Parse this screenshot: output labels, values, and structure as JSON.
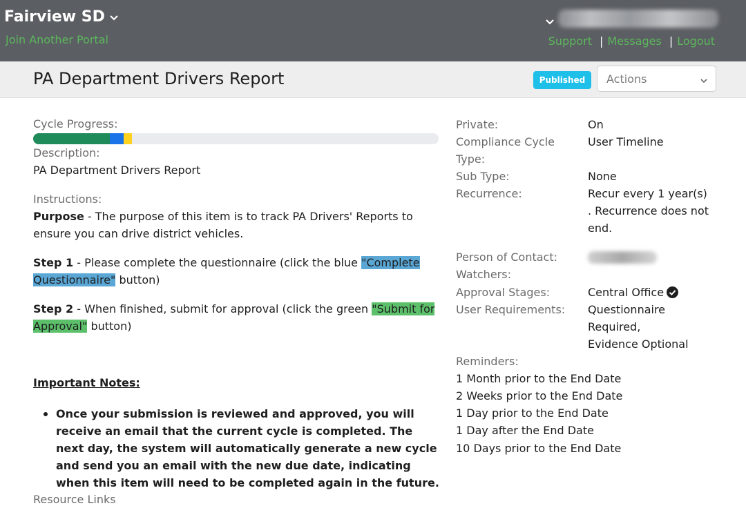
{
  "header": {
    "org_name": "Fairview SD",
    "join_portal": "Join Another Portal",
    "links": [
      "Support",
      "Messages",
      "Logout"
    ]
  },
  "titlebar": {
    "title": "PA Department Drivers Report",
    "status_badge": "Published",
    "actions_label": "Actions"
  },
  "left": {
    "cycle_progress_label": "Cycle Progress:",
    "progress_segments": [
      {
        "color": "#1f8a5a",
        "fraction": 0.189
      },
      {
        "color": "#1a73e8",
        "fraction": 0.034
      },
      {
        "color": "#ffd21f",
        "fraction": 0.021
      }
    ],
    "description_label": "Description:",
    "description": "PA Department Drivers Report",
    "instructions_label": "Instructions:",
    "purpose_bold": "Purpose",
    "purpose_text": " - The purpose of this item is to track PA Drivers' Reports to ensure you can drive district vehicles.",
    "step1_bold": "Step 1",
    "step1_text": " - Please complete the questionnaire (click the blue ",
    "step1_highlight": "\"Complete Questionnaire\"",
    "step1_tail": " button)",
    "step2_bold": "Step 2",
    "step2_text": " - When finished, submit for approval (click the green ",
    "step2_highlight": "\"Submit for Approval\"",
    "step2_tail": " button)",
    "important_notes": "Important Notes:",
    "note_1": "Once your submission is reviewed and approved, you will receive an email that the current  cycle is completed. The next day, the system will automatically generate a new cycle and send you an email with the new due date, indicating when this item will need to be completed again in the future.",
    "resource_links": "Resource Links"
  },
  "right": {
    "private_label": "Private:",
    "private_value": "On",
    "compliance_label": "Compliance Cycle Type:",
    "compliance_value": "User Timeline",
    "subtype_label": "Sub Type:",
    "subtype_value": "None",
    "recurrence_label": "Recurrence:",
    "recurrence_value": "Recur every 1 year(s) . Recurrence does not end.",
    "contact_label": "Person of Contact:",
    "watchers_label": "Watchers:",
    "approval_label": "Approval Stages:",
    "approval_value": "Central Office",
    "requirements_label": "User Requirements:",
    "requirements_line1": "Questionnaire Required,",
    "requirements_line2": "Evidence Optional",
    "reminders_label": "Reminders:",
    "reminders": [
      "1 Month prior to the End Date",
      "2 Weeks prior to the End Date",
      "1 Day prior to the End Date",
      "1 Day after the End Date",
      "10 Days prior to the End Date"
    ]
  },
  "colors": {
    "topbar": "#5b5e63",
    "link_green": "#5cb85c",
    "badge_cyan": "#1ec0e9",
    "highlight_blue": "#5aa7d6",
    "highlight_green": "#5cc06b"
  }
}
